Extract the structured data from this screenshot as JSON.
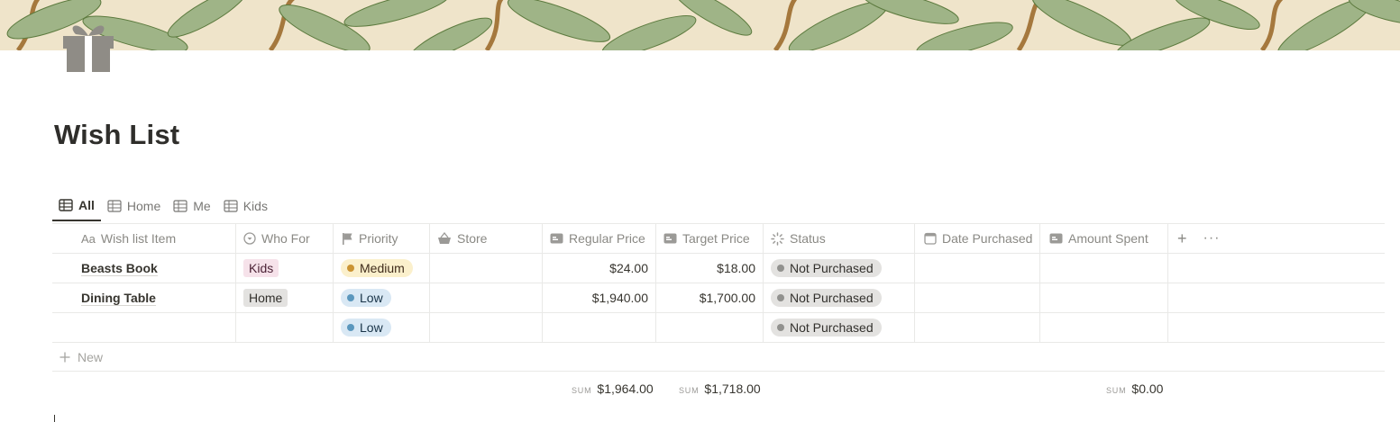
{
  "page": {
    "title": "Wish List",
    "icon": "gift-icon",
    "cover": "leaf-pattern"
  },
  "views": {
    "tabs": [
      {
        "label": "All",
        "icon": "table-icon",
        "active": true
      },
      {
        "label": "Home",
        "icon": "table-icon",
        "active": false
      },
      {
        "label": "Me",
        "icon": "table-icon",
        "active": false
      },
      {
        "label": "Kids",
        "icon": "table-icon",
        "active": false
      }
    ]
  },
  "table": {
    "columns": [
      {
        "label": "Wish list Item",
        "icon": "text-aa-icon"
      },
      {
        "label": "Who For",
        "icon": "select-icon"
      },
      {
        "label": "Priority",
        "icon": "flag-icon"
      },
      {
        "label": "Store",
        "icon": "basket-icon"
      },
      {
        "label": "Regular Price",
        "icon": "number-icon"
      },
      {
        "label": "Target Price",
        "icon": "number-icon"
      },
      {
        "label": "Status",
        "icon": "status-icon"
      },
      {
        "label": "Date Purchased",
        "icon": "calendar-icon"
      },
      {
        "label": "Amount Spent",
        "icon": "number-icon"
      }
    ],
    "rows": [
      {
        "item": "Beasts Book",
        "who_for": "Kids",
        "priority": "Medium",
        "store": "",
        "regular_price": "$24.00",
        "target_price": "$18.00",
        "status": "Not Purchased",
        "date_purchased": "",
        "amount_spent": ""
      },
      {
        "item": "Dining Table",
        "who_for": "Home",
        "priority": "Low",
        "store": "",
        "regular_price": "$1,940.00",
        "target_price": "$1,700.00",
        "status": "Not Purchased",
        "date_purchased": "",
        "amount_spent": ""
      },
      {
        "item": "",
        "who_for": "",
        "priority": "Low",
        "store": "",
        "regular_price": "",
        "target_price": "",
        "status": "Not Purchased",
        "date_purchased": "",
        "amount_spent": ""
      }
    ],
    "new_label": "New",
    "sums": {
      "label": "SUM",
      "regular_price": "$1,964.00",
      "target_price": "$1,718.00",
      "amount_spent": "$0.00"
    }
  },
  "colors": {
    "tag_kids": "#f6e2ea",
    "tag_home": "#e3e2e0",
    "priority_medium": "#fbf0cc",
    "priority_low": "#d9e8f4",
    "status_not_purchased": "#e3e2e0"
  }
}
